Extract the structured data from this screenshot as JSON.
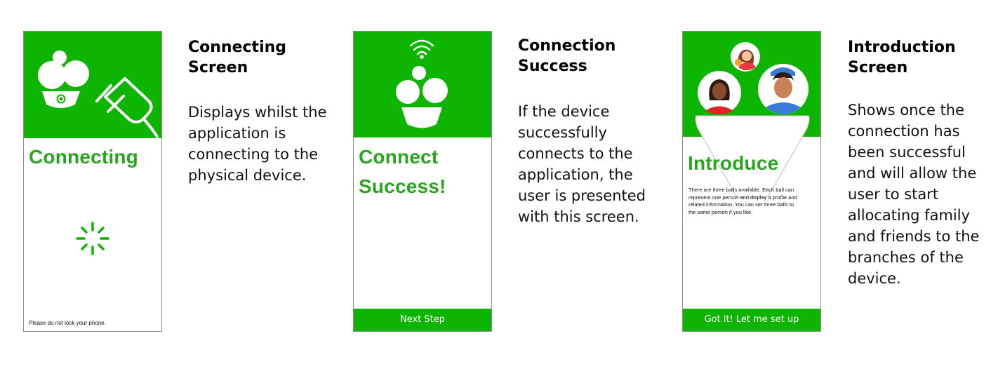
{
  "colors": {
    "brand_green": "#0db400",
    "title_green": "#2aa51e"
  },
  "screens": [
    {
      "title": "Connecting",
      "footer_note": "Please do not lock your phone.",
      "icons": [
        "balls-bowl-icon",
        "plug-icon",
        "spinner-icon"
      ],
      "caption_title_line1": "Connecting",
      "caption_title_line2": "Screen",
      "caption_lines": [
        "Displays whilst the",
        "application is",
        "connecting to the",
        "physical device."
      ]
    },
    {
      "title_line1": "Connect",
      "title_line2": "Success!",
      "button": "Next Step",
      "icons": [
        "wifi-icon",
        "balls-bowl-icon"
      ],
      "caption_title_line1": "Connection",
      "caption_title_line2": "Success",
      "caption_lines": [
        "If the device",
        "successfully",
        "connects to the",
        "application, the",
        "user is presented",
        "with this screen."
      ]
    },
    {
      "title": "Introduce",
      "body_lines": [
        "There are three balls available. Each ball can",
        "represent one person and display a profile and",
        "related information. You can set three balls to",
        "the same person if you like."
      ],
      "button": "Got it! Let me set up",
      "icons": [
        "avatar-woman-icon",
        "avatar-mother-child-icon",
        "avatar-man-icon"
      ],
      "caption_title_line1": "Introduction",
      "caption_title_line2": "Screen",
      "caption_lines": [
        "Shows once the",
        "connection has",
        "been successful",
        "and will allow the",
        "user to start",
        "allocating family",
        "and friends to the",
        "branches of the",
        "device."
      ]
    }
  ]
}
